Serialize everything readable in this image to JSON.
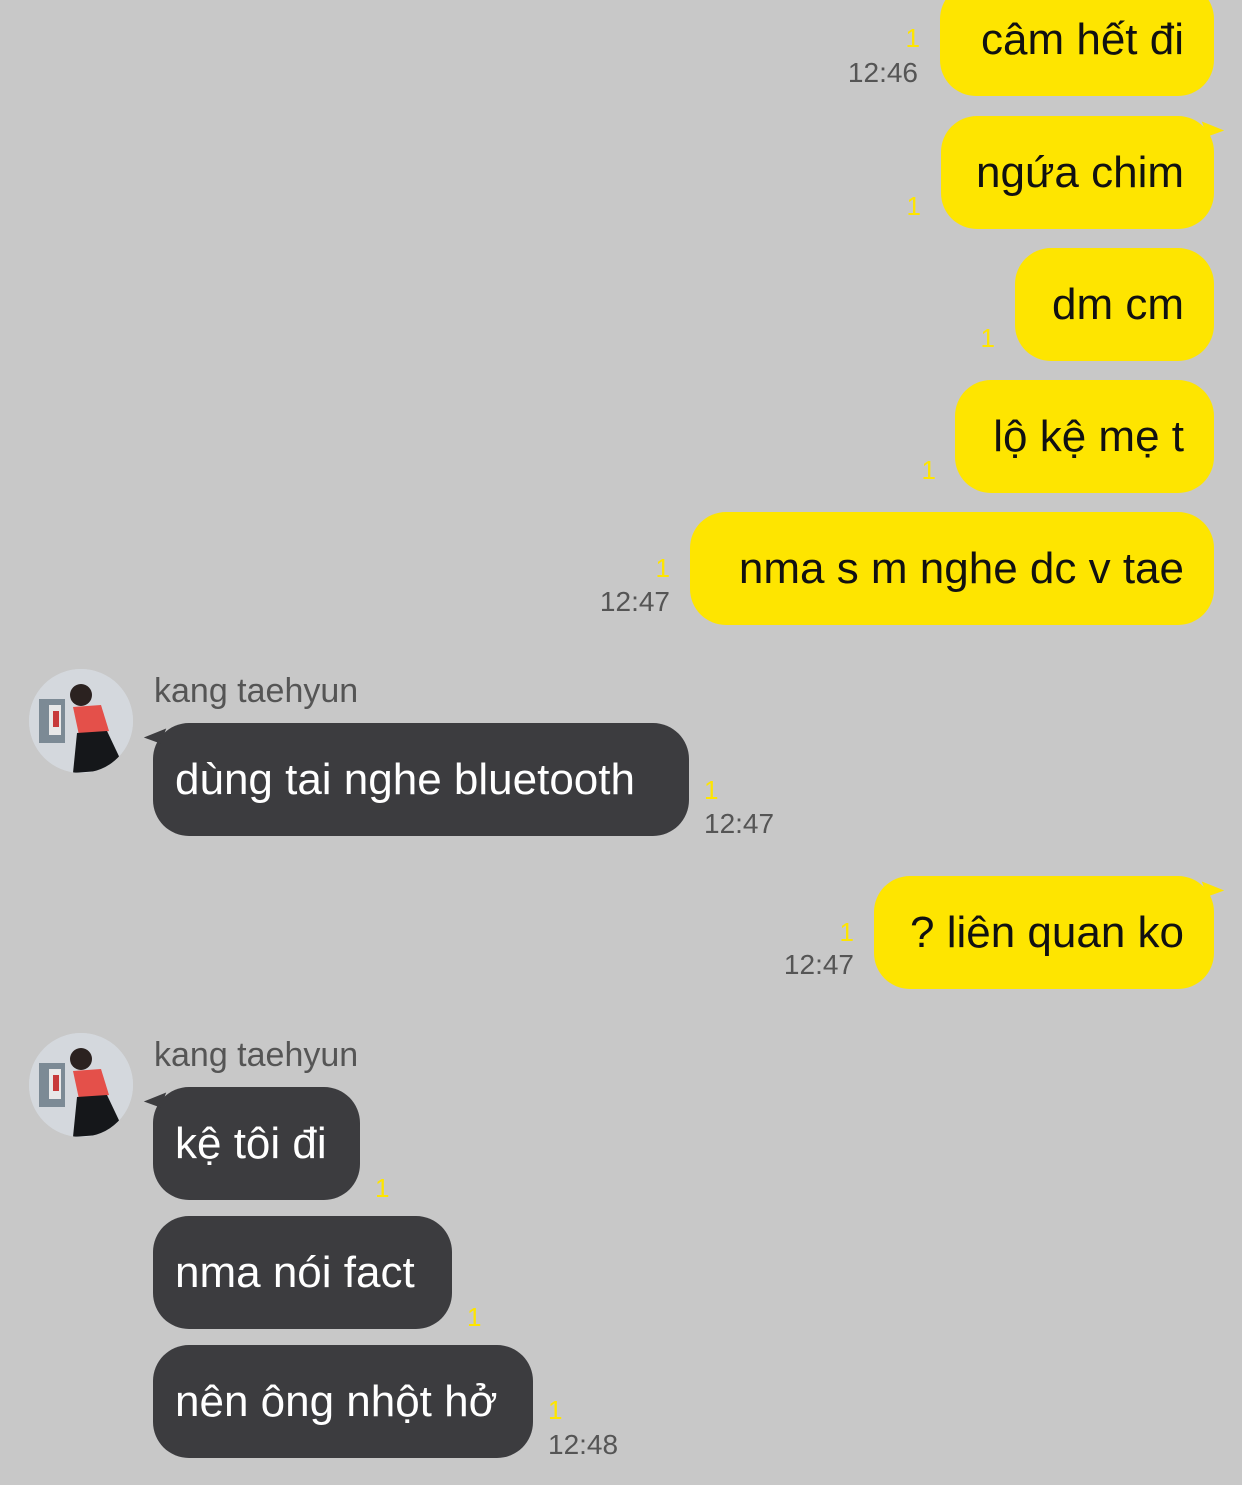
{
  "messages": [
    {
      "text": "câm hết đi",
      "unread": "1",
      "time": "12:46"
    },
    {
      "text": "ngứa chim",
      "unread": "1"
    },
    {
      "text": "dm cm",
      "unread": "1"
    },
    {
      "text": "lộ kệ mẹ t",
      "unread": "1"
    },
    {
      "text": "nma s m nghe dc v tae",
      "unread": "1",
      "time": "12:47"
    },
    {
      "sender": "kang taehyun",
      "text": "dùng tai nghe bluetooth",
      "unread": "1",
      "time": "12:47"
    },
    {
      "text": "? liên quan ko",
      "unread": "1",
      "time": "12:47"
    },
    {
      "sender": "kang taehyun",
      "text": "kệ tôi đi",
      "unread": "1"
    },
    {
      "text": "nma nói fact",
      "unread": "1"
    },
    {
      "text": "nên ông nhột hở",
      "unread": "1",
      "time": "12:48"
    }
  ],
  "colors": {
    "background": "#c8c8c8",
    "outgoing_bubble": "#fee500",
    "incoming_bubble": "#3c3c3f",
    "unread_count": "#fee500",
    "timestamp": "#555555"
  }
}
